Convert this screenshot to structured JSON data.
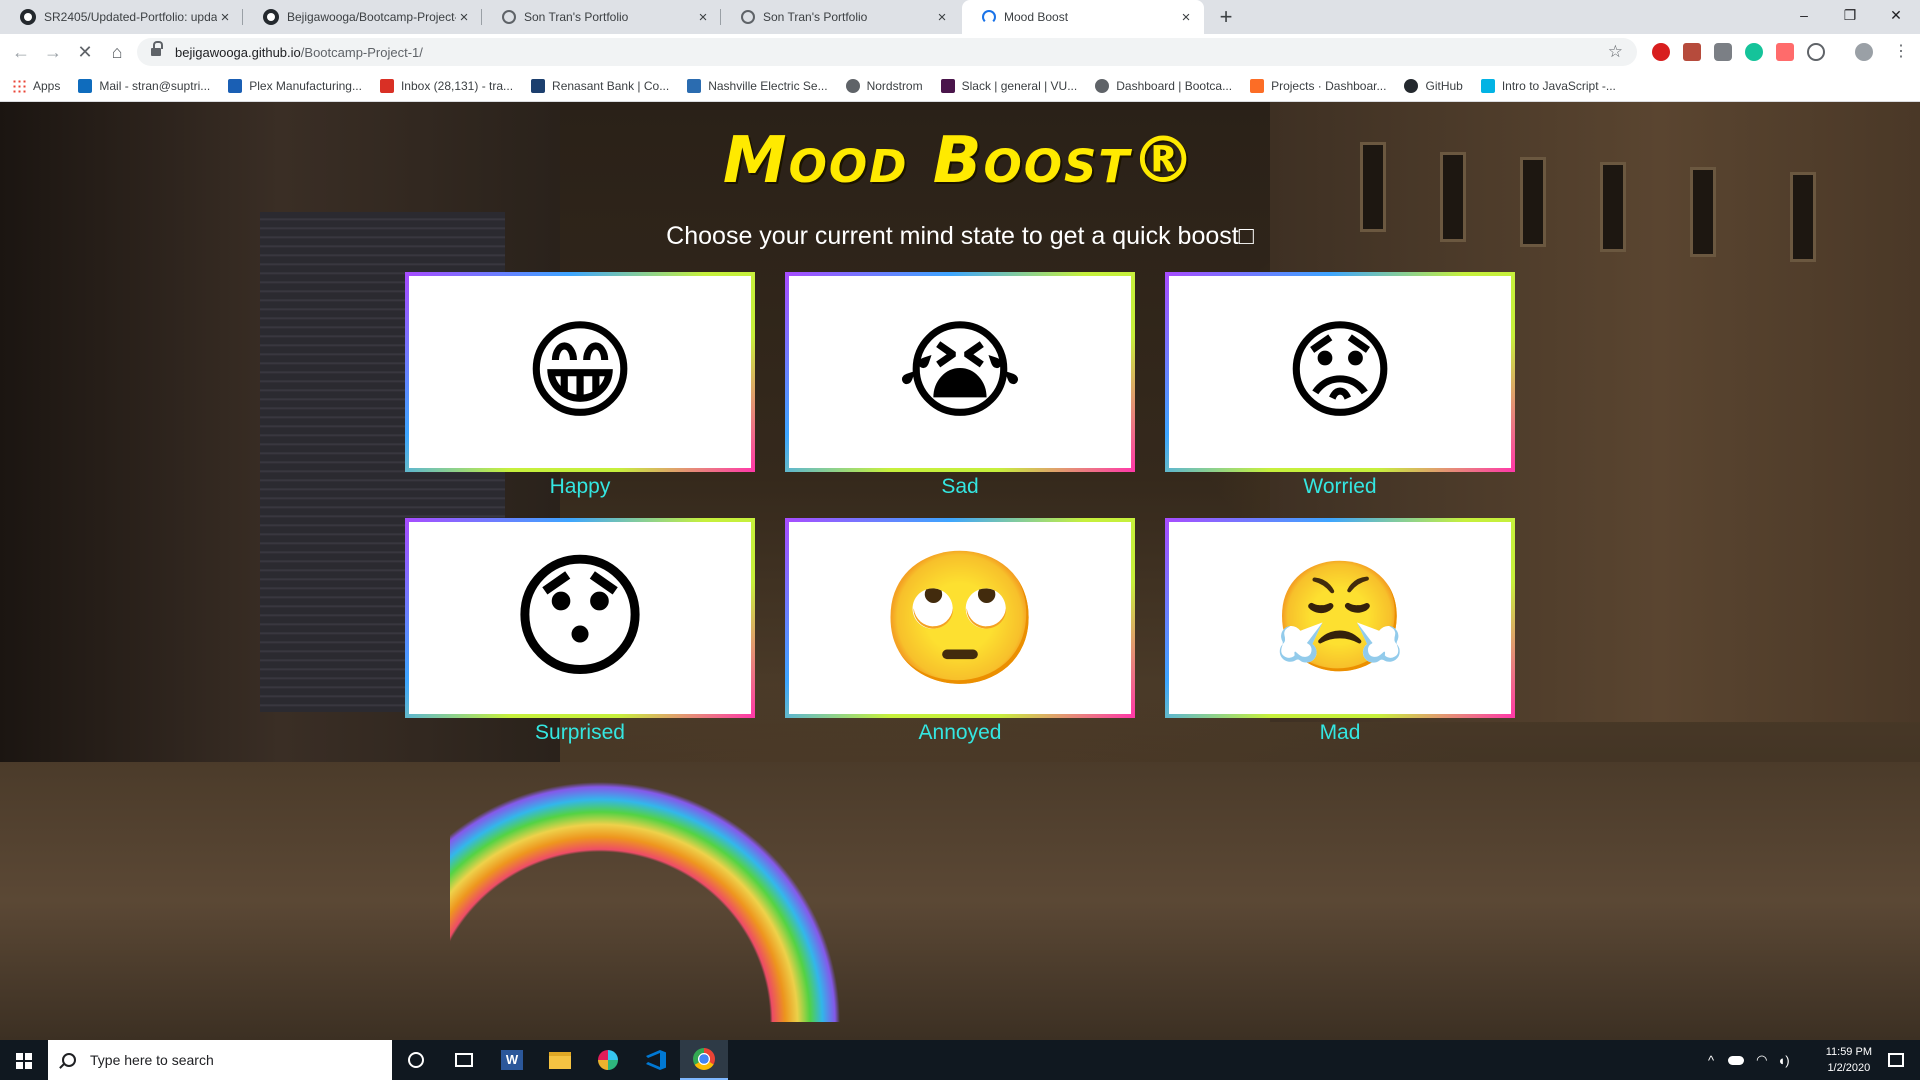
{
  "browser": {
    "tabs": [
      {
        "title": "SR2405/Updated-Portfolio: upda",
        "icon": "github-icon",
        "active": false
      },
      {
        "title": "Bejigawooga/Bootcamp-Project-",
        "icon": "github-icon",
        "active": false
      },
      {
        "title": "Son Tran's Portfolio",
        "icon": "globe-icon",
        "active": false
      },
      {
        "title": "Son Tran's Portfolio",
        "icon": "globe-icon",
        "active": false
      },
      {
        "title": "Mood Boost",
        "icon": "loading-icon",
        "active": true
      }
    ],
    "new_tab": "+",
    "window_controls": {
      "minimize": "–",
      "maximize": "❐",
      "close": "✕"
    },
    "url_host": "bejigawooga.github.io",
    "url_path": "/Bootcamp-Project-1/",
    "bookmarks": [
      {
        "label": "Apps",
        "icon": "apps-grid-icon",
        "color": "#ea4335"
      },
      {
        "label": "Mail - stran@suptri...",
        "icon": "outlook-icon",
        "color": "#0f6cbd"
      },
      {
        "label": "Plex Manufacturing...",
        "icon": "plex-icon",
        "color": "#1a5fb4"
      },
      {
        "label": "Inbox (28,131) - tra...",
        "icon": "gmail-icon",
        "color": "#d93025"
      },
      {
        "label": "Renasant Bank | Co...",
        "icon": "bank-icon",
        "color": "#1c3f6e"
      },
      {
        "label": "Nashville Electric Se...",
        "icon": "nes-icon",
        "color": "#2b6cb0"
      },
      {
        "label": "Nordstrom",
        "icon": "globe-icon",
        "color": "#5f6368"
      },
      {
        "label": "Slack | general | VU...",
        "icon": "slack-icon",
        "color": "#4a154b"
      },
      {
        "label": "Dashboard | Bootca...",
        "icon": "globe-icon",
        "color": "#5f6368"
      },
      {
        "label": "Projects · Dashboar...",
        "icon": "gitlab-icon",
        "color": "#fc6d26"
      },
      {
        "label": "GitHub",
        "icon": "github-icon",
        "color": "#24292e"
      },
      {
        "label": "Intro to JavaScript -...",
        "icon": "udacity-icon",
        "color": "#02b3e4"
      }
    ]
  },
  "app": {
    "title": "Mood Boost®",
    "subtitle": "Choose your current mind state to get a quick boost□",
    "label_color": "#34e6e1",
    "title_color": "#ffea00",
    "moods": [
      {
        "label": "Happy",
        "emoji": "😁",
        "icon": "grinning-face-icon"
      },
      {
        "label": "Sad",
        "emoji": "😭",
        "icon": "crying-face-icon"
      },
      {
        "label": "Worried",
        "emoji": "😟",
        "icon": "worried-face-icon"
      },
      {
        "label": "Surprised",
        "emoji": "😯",
        "icon": "hushed-face-icon"
      },
      {
        "label": "Annoyed",
        "emoji": "🙄",
        "icon": "eye-roll-face-icon"
      },
      {
        "label": "Mad",
        "emoji": "😤",
        "icon": "steam-nose-face-icon"
      }
    ]
  },
  "taskbar": {
    "search_placeholder": "Type here to search",
    "apps": [
      "cortana-icon",
      "task-view-icon",
      "word-icon",
      "file-explorer-icon",
      "slack-icon",
      "vscode-icon",
      "chrome-icon"
    ],
    "time": "11:59 PM",
    "date": "1/2/2020"
  }
}
